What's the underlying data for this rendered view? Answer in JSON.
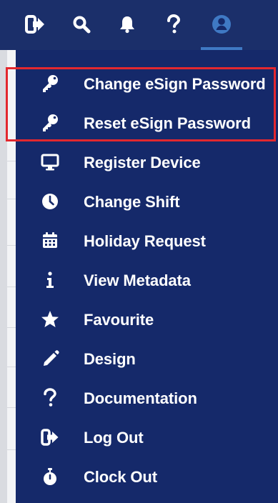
{
  "colors": {
    "topbar_bg": "#1b2f6a",
    "menu_bg": "#15296a",
    "highlight_border": "#e3282f",
    "active_underline": "#3f79c4",
    "avatar_blue": "#3f79c4"
  },
  "topbar": {
    "icons": [
      {
        "name": "logout-icon"
      },
      {
        "name": "search-icon"
      },
      {
        "name": "bell-icon"
      },
      {
        "name": "help-icon"
      },
      {
        "name": "user-avatar-icon"
      }
    ]
  },
  "menu": {
    "items": [
      {
        "label": "Change eSign Password",
        "icon": "key-icon"
      },
      {
        "label": "Reset eSign Password",
        "icon": "key-icon"
      },
      {
        "label": "Register Device",
        "icon": "monitor-icon"
      },
      {
        "label": "Change Shift",
        "icon": "clock-icon"
      },
      {
        "label": "Holiday Request",
        "icon": "calendar-icon"
      },
      {
        "label": "View Metadata",
        "icon": "info-icon"
      },
      {
        "label": "Favourite",
        "icon": "star-icon"
      },
      {
        "label": "Design",
        "icon": "pencil-icon"
      },
      {
        "label": "Documentation",
        "icon": "question-icon"
      },
      {
        "label": "Log Out",
        "icon": "logout-icon"
      },
      {
        "label": "Clock Out",
        "icon": "stopwatch-icon"
      }
    ]
  }
}
